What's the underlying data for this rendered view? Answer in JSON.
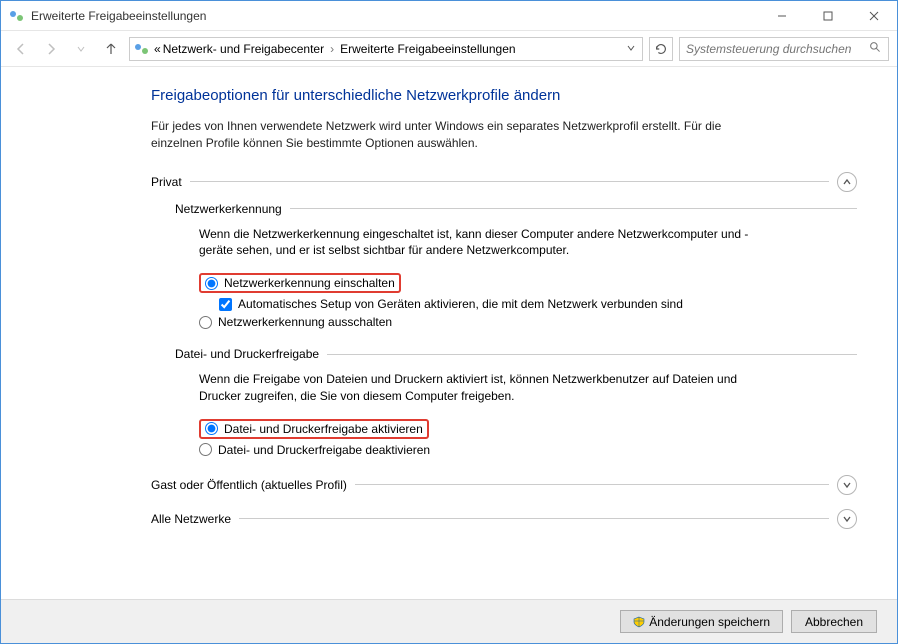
{
  "window": {
    "title": "Erweiterte Freigabeeinstellungen"
  },
  "breadcrumb": {
    "prefix": "«",
    "item1": "Netzwerk- und Freigabecenter",
    "item2": "Erweiterte Freigabeeinstellungen"
  },
  "search": {
    "placeholder": "Systemsteuerung durchsuchen"
  },
  "page": {
    "heading": "Freigabeoptionen für unterschiedliche Netzwerkprofile ändern",
    "intro": "Für jedes von Ihnen verwendete Netzwerk wird unter Windows ein separates Netzwerkprofil erstellt. Für die einzelnen Profile können Sie bestimmte Optionen auswählen."
  },
  "profiles": {
    "private": {
      "label": "Privat",
      "network_discovery": {
        "title": "Netzwerkerkennung",
        "desc": "Wenn die Netzwerkerkennung eingeschaltet ist, kann dieser Computer andere Netzwerkcomputer und -geräte sehen, und er ist selbst sichtbar für andere Netzwerkcomputer.",
        "opt_on": "Netzwerkerkennung einschalten",
        "opt_auto": "Automatisches Setup von Geräten aktivieren, die mit dem Netzwerk verbunden sind",
        "opt_off": "Netzwerkerkennung ausschalten"
      },
      "file_printer": {
        "title": "Datei- und Druckerfreigabe",
        "desc": "Wenn die Freigabe von Dateien und Druckern aktiviert ist, können Netzwerkbenutzer auf Dateien und Drucker zugreifen, die Sie von diesem Computer freigeben.",
        "opt_on": "Datei- und Druckerfreigabe aktivieren",
        "opt_off": "Datei- und Druckerfreigabe deaktivieren"
      }
    },
    "guest": {
      "label": "Gast oder Öffentlich (aktuelles Profil)"
    },
    "all": {
      "label": "Alle Netzwerke"
    }
  },
  "footer": {
    "save": "Änderungen speichern",
    "cancel": "Abbrechen"
  }
}
